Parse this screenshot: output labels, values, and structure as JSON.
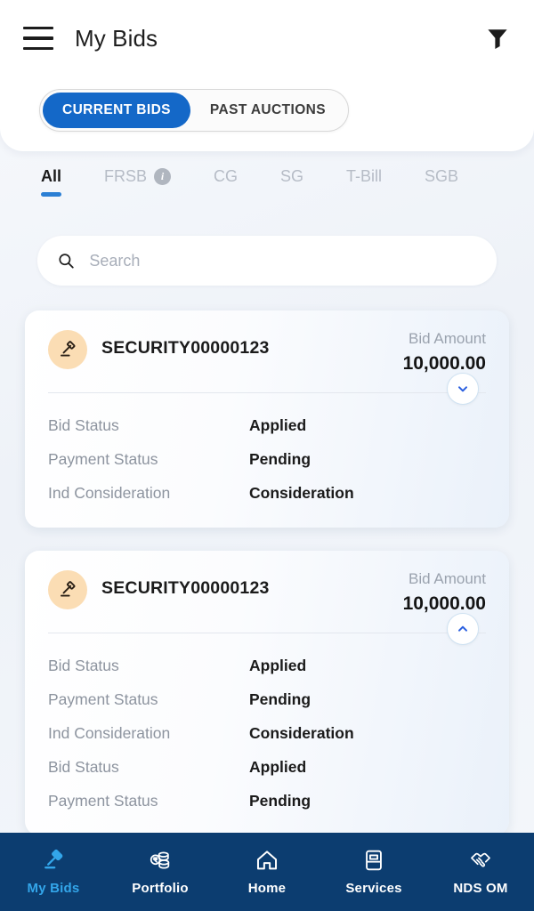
{
  "header": {
    "menu_icon": "hamburger-menu-icon",
    "title": "My Bids",
    "filter_icon": "filter-funnel-icon",
    "segmented": {
      "active": "CURRENT BIDS",
      "inactive": "PAST AUCTIONS"
    }
  },
  "tabs": [
    {
      "label": "All",
      "active": true,
      "info": false
    },
    {
      "label": "FRSB",
      "active": false,
      "info": true,
      "info_glyph": "i"
    },
    {
      "label": "CG",
      "active": false,
      "info": false
    },
    {
      "label": "SG",
      "active": false,
      "info": false
    },
    {
      "label": "T-Bill",
      "active": false,
      "info": false
    },
    {
      "label": "SGB",
      "active": false,
      "info": false
    }
  ],
  "search": {
    "icon": "search-icon",
    "placeholder": "Search",
    "value": ""
  },
  "cards": [
    {
      "icon": "gavel-icon",
      "security": "SECURITY00000123",
      "amount_label": "Bid Amount",
      "amount_value": "10,000.00",
      "toggle_icon": "chevron-down-icon",
      "expanded": false,
      "details": [
        {
          "label": "Bid Status",
          "value": "Applied"
        },
        {
          "label": "Payment Status",
          "value": "Pending"
        },
        {
          "label": "Ind Consideration",
          "value": "Consideration"
        }
      ]
    },
    {
      "icon": "gavel-icon",
      "security": "SECURITY00000123",
      "amount_label": "Bid Amount",
      "amount_value": "10,000.00",
      "toggle_icon": "chevron-up-icon",
      "expanded": true,
      "details": [
        {
          "label": "Bid Status",
          "value": "Applied"
        },
        {
          "label": "Payment Status",
          "value": "Pending"
        },
        {
          "label": "Ind Consideration",
          "value": "Consideration"
        },
        {
          "label": "Bid Status",
          "value": "Applied"
        },
        {
          "label": "Payment Status",
          "value": "Pending"
        }
      ]
    }
  ],
  "bottom_nav": [
    {
      "label": "My Bids",
      "icon": "gavel-icon",
      "active": true
    },
    {
      "label": "Portfolio",
      "icon": "rupee-coins-icon",
      "active": false
    },
    {
      "label": "Home",
      "icon": "home-icon",
      "active": false
    },
    {
      "label": "Services",
      "icon": "document-icon",
      "active": false
    },
    {
      "label": "NDS OM",
      "icon": "handshake-icon",
      "active": false
    }
  ],
  "colors": {
    "accent_blue": "#1468c8",
    "nav_background": "#0c3d70",
    "nav_active": "#33a6ea",
    "gavel_badge": "#fbddb4",
    "tab_underline": "#2b7fd4"
  }
}
